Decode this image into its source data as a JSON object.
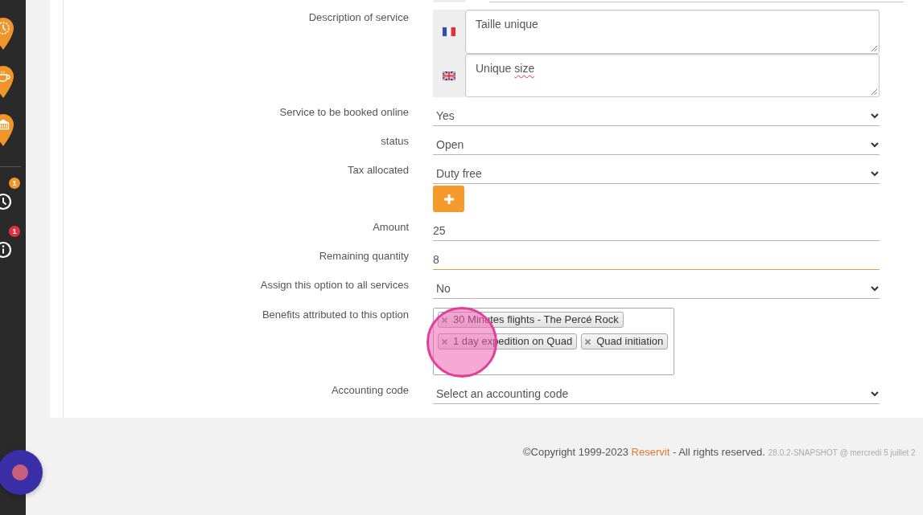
{
  "sidebar": {
    "pins": [
      {
        "kind": "clock"
      },
      {
        "kind": "cup"
      },
      {
        "kind": "building"
      }
    ],
    "alerts": [
      {
        "kind": "clock",
        "count": "1",
        "color": "#f0962a"
      },
      {
        "kind": "info",
        "count": "1",
        "color": "#e3323c"
      }
    ]
  },
  "form": {
    "rows": [
      {
        "kind": "translations",
        "label": "Description of service",
        "translations": [
          {
            "kind": "france",
            "words": [
              {
                "text": "Taille",
                "misspelled": false
              },
              {
                "text": "unique",
                "misspelled": false
              }
            ]
          },
          {
            "kind": "uk",
            "words": [
              {
                "text": "Unique",
                "misspelled": false
              },
              {
                "text": "size",
                "misspelled": true
              }
            ]
          }
        ]
      },
      {
        "kind": "select",
        "label": "Service to be booked online",
        "value": "Yes"
      },
      {
        "kind": "select",
        "label": "status",
        "value": "Open"
      },
      {
        "kind": "select",
        "label": "Tax allocated",
        "value": "Duty free",
        "add_button": true
      },
      {
        "kind": "input",
        "label": "Amount",
        "value": "25",
        "focused": false
      },
      {
        "kind": "input",
        "label": "Remaining quantity",
        "value": "8",
        "focused": true
      },
      {
        "kind": "select",
        "label": "Assign this option to all services",
        "value": "No"
      },
      {
        "kind": "tags",
        "label": "Benefits attributed to this option",
        "tags": [
          {
            "text": "30 Minutes flights - The Percé Rock"
          },
          {
            "text": "1 day expedition on Quad"
          },
          {
            "text": "Quad initiation"
          }
        ]
      },
      {
        "kind": "select",
        "label": "Accounting code",
        "value": "Select an accounting code"
      }
    ]
  },
  "click_indicator": {
    "visible": true
  },
  "footer": {
    "copyright": "©Copyright 1999-2023",
    "link": "Reservit",
    "rights": "- All rights reserved.",
    "build": "28.0.2-SNAPSHOT @ mercredi 5 juillet 2"
  }
}
